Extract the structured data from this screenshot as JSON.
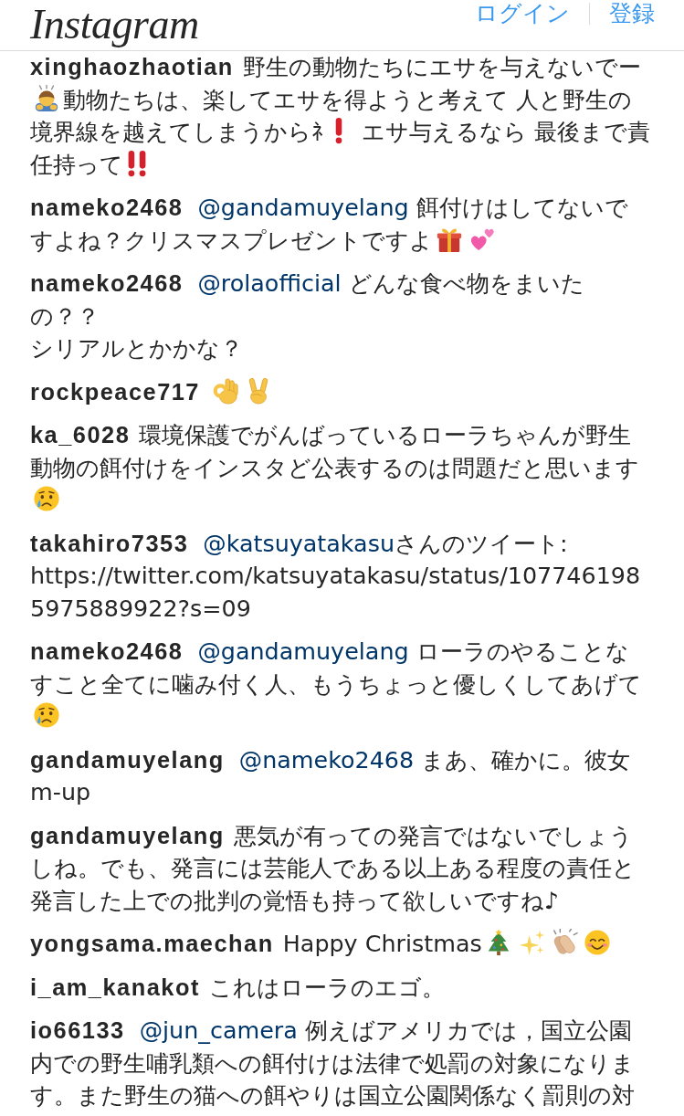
{
  "header": {
    "logo": "Instagram",
    "login": "ログイン",
    "signup": "登録"
  },
  "comments": [
    {
      "username": "xinghaozhaotian",
      "body": [
        {
          "kind": "text",
          "text": "野生の動物たちにエサを与えないでー"
        },
        {
          "kind": "bow"
        },
        {
          "kind": "text",
          "text": "動物たちは、楽してエサを得ようと考えて 人と野生の境界線を越えてしまうからﾈ"
        },
        {
          "kind": "exclaim"
        },
        {
          "kind": "text",
          "text": " エサ与えるなら 最後まで責任持って"
        },
        {
          "kind": "exclaims"
        }
      ]
    },
    {
      "username": "nameko2468",
      "body": [
        {
          "kind": "mention",
          "text": "@gandamuyelang"
        },
        {
          "kind": "text",
          "text": " 餌付けはしてないですよね？クリスマスプレゼントですよ"
        },
        {
          "kind": "gift"
        },
        {
          "kind": "hearts"
        }
      ]
    },
    {
      "username": "nameko2468",
      "body": [
        {
          "kind": "mention",
          "text": "@rolaofficial"
        },
        {
          "kind": "text",
          "text": " どんな食べ物をまいたの？？"
        },
        {
          "kind": "newline"
        },
        {
          "kind": "text",
          "text": "シリアルとかかな？"
        }
      ]
    },
    {
      "username": "rockpeace717",
      "body": [
        {
          "kind": "okhand"
        },
        {
          "kind": "peace"
        }
      ]
    },
    {
      "username": "ka_6028",
      "body": [
        {
          "kind": "text",
          "text": "環境保護でがんばっているローラちゃんが野生動物の餌付けをインスタど公表するのは問題だと思います"
        },
        {
          "kind": "crying"
        }
      ]
    },
    {
      "username": "takahiro7353",
      "body": [
        {
          "kind": "mention",
          "text": "@katsuyatakasu"
        },
        {
          "kind": "text",
          "text": "さんのツイート: https://twitter.com/katsuyatakasu/status/1077461985975889922?s=09"
        }
      ]
    },
    {
      "username": "nameko2468",
      "body": [
        {
          "kind": "mention",
          "text": "@gandamuyelang"
        },
        {
          "kind": "text",
          "text": " ローラのやることなすこと全てに噛み付く人、もうちょっと優しくしてあげて"
        },
        {
          "kind": "crying"
        }
      ]
    },
    {
      "username": "gandamuyelang",
      "body": [
        {
          "kind": "mention",
          "text": "@nameko2468"
        },
        {
          "kind": "text",
          "text": " まあ、確かに。彼女m-up"
        }
      ]
    },
    {
      "username": "gandamuyelang",
      "body": [
        {
          "kind": "text",
          "text": "悪気が有っての発言ではないでしょうしね。でも、発言には芸能人である以上ある程度の責任と発言した上での批判の覚悟も持って欲しいですね♪"
        }
      ]
    },
    {
      "username": "yongsama.maechan",
      "body": [
        {
          "kind": "text",
          "text": "Happy Christmas"
        },
        {
          "kind": "tree"
        },
        {
          "kind": "sparkles"
        },
        {
          "kind": "clap"
        },
        {
          "kind": "smile"
        }
      ]
    },
    {
      "username": "i_am_kanakot",
      "body": [
        {
          "kind": "text",
          "text": "これはローラのエゴ。"
        }
      ]
    },
    {
      "username": "io66133",
      "body": [
        {
          "kind": "mention",
          "text": "@jun_camera"
        },
        {
          "kind": "text",
          "text": " 例えばアメリカでは，国立公園内での野生哺乳類への餌付けは法律で処罰の対象になります。また野生の猫への餌やりは国立公園関係なく罰則の対"
        }
      ]
    }
  ]
}
